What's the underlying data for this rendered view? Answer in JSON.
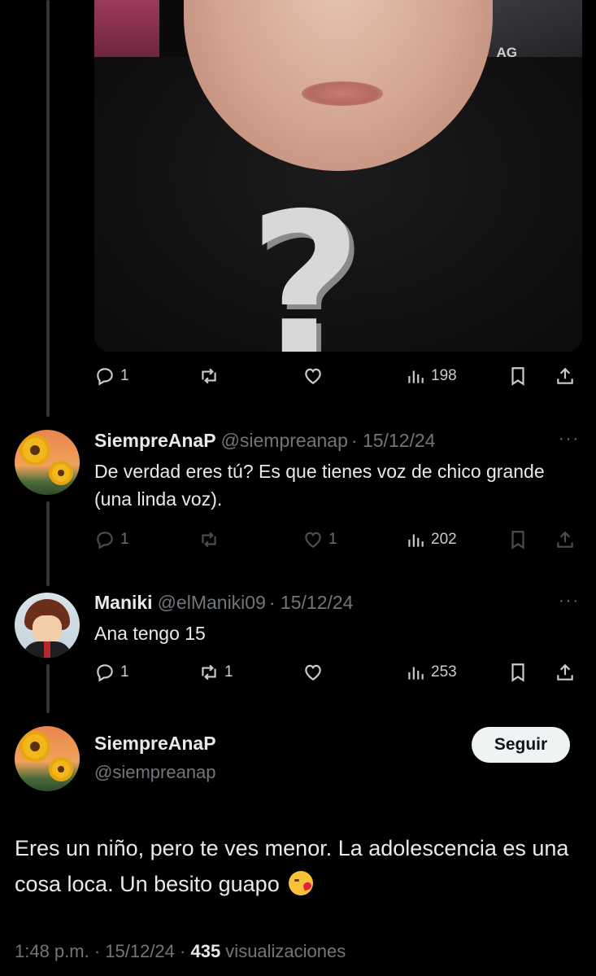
{
  "media": {
    "overlay_tag": "AG",
    "overlay_symbol": "?"
  },
  "top_post_actions": {
    "replies": "1",
    "reposts": "",
    "likes": "",
    "views": "198"
  },
  "reply1": {
    "name": "SiempreAnaP",
    "handle": "@siempreanap",
    "date": "· 15/12/24",
    "text": "De verdad eres tú? Es que tienes voz de chico grande (una linda voz).",
    "replies": "1",
    "reposts": "",
    "likes": "1",
    "views": "202"
  },
  "reply2": {
    "name": "Maniki",
    "handle": "@elManiki09",
    "date": "· 15/12/24",
    "text": "Ana tengo 15",
    "replies": "1",
    "reposts": "1",
    "likes": "",
    "views": "253"
  },
  "main_post": {
    "name": "SiempreAnaP",
    "handle": "@siempreanap",
    "follow_label": "Seguir",
    "text": "Eres un niño, pero te ves menor. La adolescencia es una cosa loca. Un besito guapo",
    "time": "1:48 p.m. · 15/12/24 · ",
    "views_count": "435",
    "views_label": " visualizaciones"
  },
  "more_label": "···",
  "icons": [
    "reply-icon",
    "repost-icon",
    "like-icon",
    "views-icon",
    "bookmark-icon",
    "share-icon",
    "kissing-face-emoji"
  ]
}
